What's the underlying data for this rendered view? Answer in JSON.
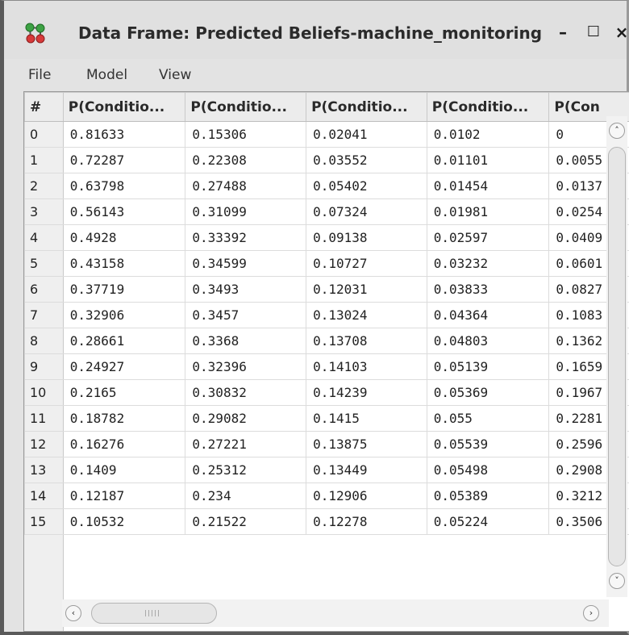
{
  "window": {
    "title": "Data Frame: Predicted Beliefs-machine_monitoring",
    "minimize_glyph": "–",
    "maximize_glyph": "☐",
    "close_glyph": "×",
    "icon": "network-graph-icon"
  },
  "menu": {
    "file": "File",
    "model": "Model",
    "view": "View"
  },
  "table": {
    "columns": [
      "#",
      "P(Conditio...",
      "P(Conditio...",
      "P(Conditio...",
      "P(Conditio...",
      "P(Con"
    ],
    "rows": [
      [
        "0",
        "0.81633",
        "0.15306",
        "0.02041",
        "0.0102",
        "0"
      ],
      [
        "1",
        "0.72287",
        "0.22308",
        "0.03552",
        "0.01101",
        "0.0055"
      ],
      [
        "2",
        "0.63798",
        "0.27488",
        "0.05402",
        "0.01454",
        "0.0137"
      ],
      [
        "3",
        "0.56143",
        "0.31099",
        "0.07324",
        "0.01981",
        "0.0254"
      ],
      [
        "4",
        "0.4928",
        "0.33392",
        "0.09138",
        "0.02597",
        "0.0409"
      ],
      [
        "5",
        "0.43158",
        "0.34599",
        "0.10727",
        "0.03232",
        "0.0601"
      ],
      [
        "6",
        "0.37719",
        "0.3493",
        "0.12031",
        "0.03833",
        "0.0827"
      ],
      [
        "7",
        "0.32906",
        "0.3457",
        "0.13024",
        "0.04364",
        "0.1083"
      ],
      [
        "8",
        "0.28661",
        "0.3368",
        "0.13708",
        "0.04803",
        "0.1362"
      ],
      [
        "9",
        "0.24927",
        "0.32396",
        "0.14103",
        "0.05139",
        "0.1659"
      ],
      [
        "10",
        "0.2165",
        "0.30832",
        "0.14239",
        "0.05369",
        "0.1967"
      ],
      [
        "11",
        "0.18782",
        "0.29082",
        "0.1415",
        "0.055",
        "0.2281"
      ],
      [
        "12",
        "0.16276",
        "0.27221",
        "0.13875",
        "0.05539",
        "0.2596"
      ],
      [
        "13",
        "0.1409",
        "0.25312",
        "0.13449",
        "0.05498",
        "0.2908"
      ],
      [
        "14",
        "0.12187",
        "0.234",
        "0.12906",
        "0.05389",
        "0.3212"
      ],
      [
        "15",
        "0.10532",
        "0.21522",
        "0.12278",
        "0.05224",
        "0.3506"
      ]
    ]
  },
  "scrollbars": {
    "up_glyph": "˄",
    "down_glyph": "˅",
    "left_glyph": "‹",
    "right_glyph": "›"
  }
}
